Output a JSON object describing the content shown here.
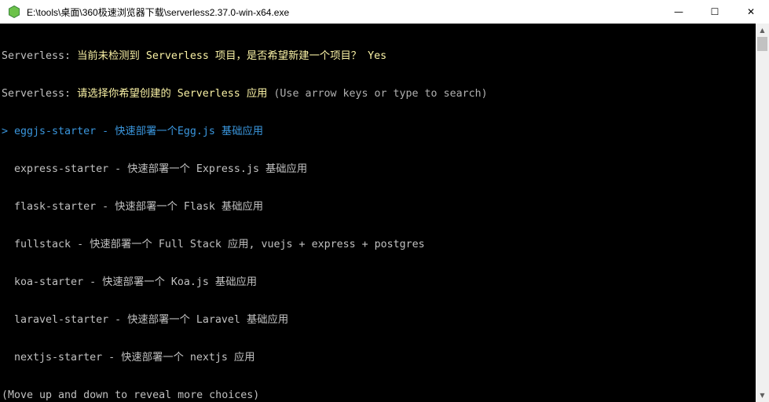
{
  "window": {
    "title": "E:\\tools\\桌面\\360极速浏览器下载\\serverless2.37.0-win-x64.exe",
    "minimize_glyph": "—",
    "maximize_glyph": "☐",
    "close_glyph": "✕",
    "icon": "nodejs-hexagon-icon",
    "icon_color": "#6cc24a"
  },
  "console": {
    "prompt1_label": "Serverless: ",
    "prompt1_question": "当前未检测到 Serverless 项目，是否希望新建一个项目？ ",
    "prompt1_answer": "Yes",
    "prompt2_label": "Serverless: ",
    "prompt2_question": "请选择你希望创建的 Serverless 应用 ",
    "prompt2_hint": "(Use arrow keys or type to search)",
    "choices": [
      {
        "text": "> eggjs-starter - 快速部署一个Egg.js 基础应用",
        "selected": true
      },
      {
        "text": "  express-starter - 快速部署一个 Express.js 基础应用",
        "selected": false
      },
      {
        "text": "  flask-starter - 快速部署一个 Flask 基础应用",
        "selected": false
      },
      {
        "text": "  fullstack - 快速部署一个 Full Stack 应用, vuejs + express + postgres",
        "selected": false
      },
      {
        "text": "  koa-starter - 快速部署一个 Koa.js 基础应用",
        "selected": false
      },
      {
        "text": "  laravel-starter - 快速部署一个 Laravel 基础应用",
        "selected": false
      },
      {
        "text": "  nextjs-starter - 快速部署一个 nextjs 应用",
        "selected": false
      }
    ],
    "footer_hint": "(Move up and down to reveal more choices)"
  },
  "colors": {
    "background": "#000000",
    "text": "#c0c0c0",
    "highlight": "#f9f1a5",
    "selected": "#3a96dd"
  },
  "scrollbar": {
    "up_glyph": "▲",
    "down_glyph": "▼"
  }
}
